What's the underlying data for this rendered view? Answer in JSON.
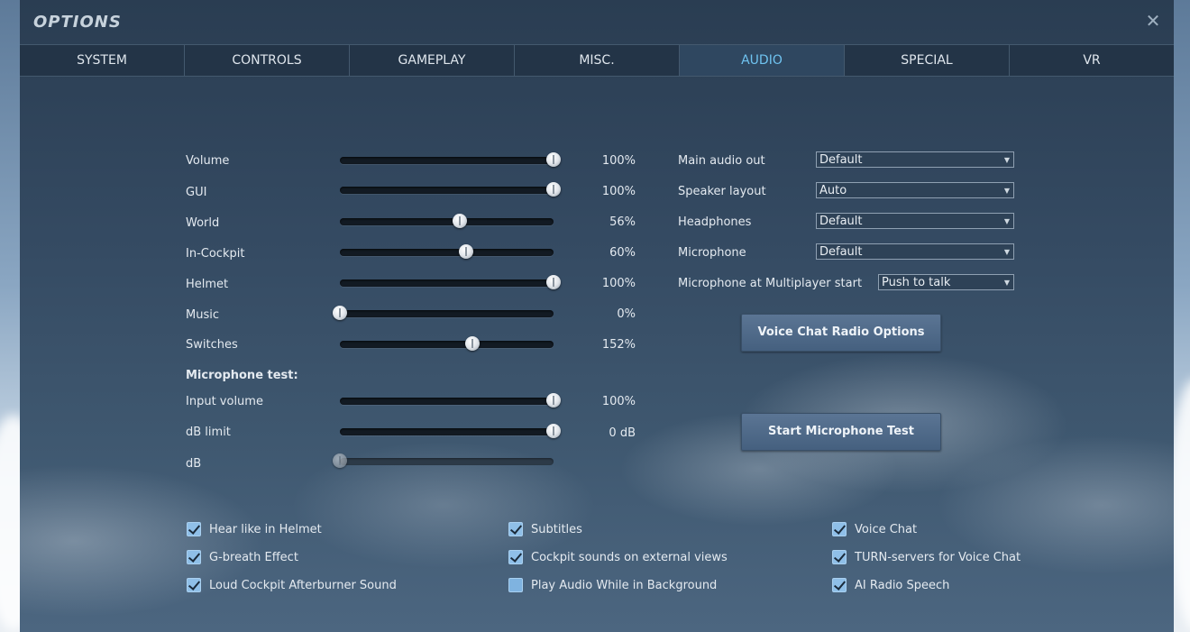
{
  "window": {
    "title": "OPTIONS",
    "close": "✕"
  },
  "tabs": [
    {
      "label": "SYSTEM",
      "active": false
    },
    {
      "label": "CONTROLS",
      "active": false
    },
    {
      "label": "GAMEPLAY",
      "active": false
    },
    {
      "label": "MISC.",
      "active": false
    },
    {
      "label": "AUDIO",
      "active": true
    },
    {
      "label": "SPECIAL",
      "active": false
    },
    {
      "label": "VR",
      "active": false
    }
  ],
  "sliders": [
    {
      "label": "Volume",
      "value": "100%",
      "fraction": 1.0
    },
    {
      "label": "GUI",
      "value": "100%",
      "fraction": 1.0
    },
    {
      "label": "World",
      "value": "56%",
      "fraction": 0.56
    },
    {
      "label": "In-Cockpit",
      "value": "60%",
      "fraction": 0.59
    },
    {
      "label": "Helmet",
      "value": "100%",
      "fraction": 1.0
    },
    {
      "label": "Music",
      "value": "0%",
      "fraction": 0.0
    },
    {
      "label": "Switches",
      "value": "152%",
      "fraction": 0.62
    }
  ],
  "mic_test": {
    "heading": "Microphone test:",
    "sliders": [
      {
        "label": "Input volume",
        "value": "100%",
        "fraction": 1.0
      },
      {
        "label": "dB limit",
        "value": "0 dB",
        "fraction": 1.0
      },
      {
        "label": "dB",
        "value": "",
        "fraction": 0.0,
        "disabled": true
      }
    ]
  },
  "dropdowns": [
    {
      "label": "Main audio out",
      "value": "Default"
    },
    {
      "label": "Speaker layout",
      "value": "Auto"
    },
    {
      "label": "Headphones",
      "value": "Default"
    },
    {
      "label": "Microphone",
      "value": "Default"
    },
    {
      "label": "Microphone at Multiplayer start",
      "value": "Push to talk"
    }
  ],
  "buttons": {
    "voice_chat_radio": "Voice Chat Radio Options",
    "start_mic_test": "Start Microphone Test"
  },
  "checkboxes": [
    {
      "label": "Hear like in Helmet",
      "checked": true
    },
    {
      "label": "G-breath Effect",
      "checked": true
    },
    {
      "label": "Loud Cockpit Afterburner Sound",
      "checked": true
    },
    {
      "label": "Subtitles",
      "checked": true
    },
    {
      "label": "Cockpit sounds on external views",
      "checked": true
    },
    {
      "label": "Play Audio While in Background",
      "checked": false
    },
    {
      "label": "Voice Chat",
      "checked": true
    },
    {
      "label": "TURN-servers for Voice Chat",
      "checked": true
    },
    {
      "label": "AI Radio Speech",
      "checked": true
    }
  ]
}
